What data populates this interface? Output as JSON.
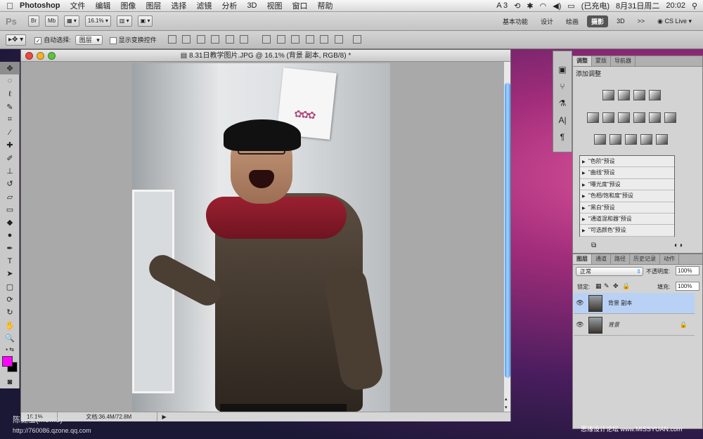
{
  "menubar": {
    "apple": "",
    "app_name": "Photoshop",
    "items": [
      "文件",
      "编辑",
      "图像",
      "图层",
      "选择",
      "滤镜",
      "分析",
      "3D",
      "视图",
      "窗口",
      "帮助"
    ],
    "status": {
      "a3": "A 3",
      "battery": "(已充电)",
      "date": "8月31日周二",
      "time": "20:02"
    }
  },
  "appbar": {
    "logo": "Ps",
    "br": "Br",
    "mb": "Mb",
    "zoom": "16.1%",
    "workspaces": [
      "基本功能",
      "设计",
      "绘画",
      "摄影",
      "3D"
    ],
    "active_workspace": "摄影",
    "more": ">>",
    "cslive": "CS Live"
  },
  "options": {
    "auto_select_label": "自动选择:",
    "auto_select_value": "图层",
    "show_transform_label": "显示变换控件"
  },
  "document": {
    "title": "8.31日教学图片.JPG @ 16.1% (背景 副本, RGB/8) *",
    "zoom": "16.1%",
    "doc_size": "文档:36.4M/72.8M"
  },
  "adjustments": {
    "tabs": [
      "调整",
      "蒙版",
      "导航器"
    ],
    "heading": "添加调整",
    "presets": [
      "\"色阶\"预设",
      "\"曲线\"预设",
      "\"曝光度\"预设",
      "\"色相/饱和度\"预设",
      "\"黑白\"预设",
      "\"通道混和器\"预设",
      "\"可选颜色\"预设"
    ]
  },
  "layers": {
    "tabs": [
      "图层",
      "通道",
      "路径",
      "历史记录",
      "动作"
    ],
    "blend_mode": "正常",
    "opacity_label": "不透明度:",
    "opacity": "100%",
    "lock_label": "锁定:",
    "fill_label": "填充:",
    "fill": "100%",
    "items": [
      {
        "name": "背景 副本",
        "selected": true
      },
      {
        "name": "背景",
        "selected": false
      }
    ]
  },
  "watermarks": {
    "left_name": "陈健宝(momo)",
    "left_url": "http://760086.qzone.qq.com",
    "right": "思缘设计论坛 www.MISSYUAN.com"
  },
  "colors": {
    "foreground": "#ff00ff",
    "background": "#000000",
    "accent": "#3d8ee8",
    "selected_layer": "#b9d1f5"
  }
}
